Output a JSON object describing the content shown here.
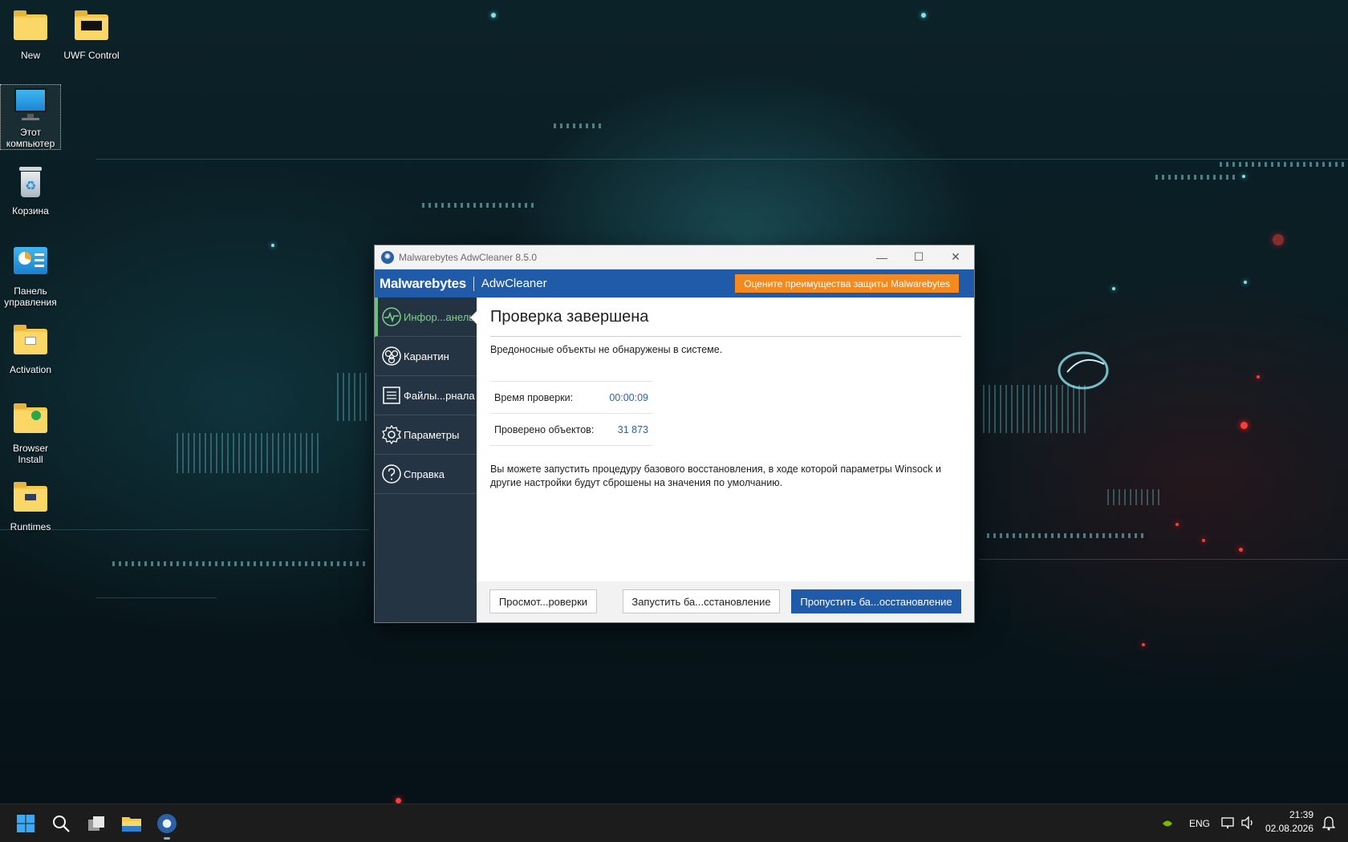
{
  "desktop": {
    "icons": [
      {
        "label": "New"
      },
      {
        "label": "UWF Control"
      },
      {
        "label": "Этот компьютер"
      },
      {
        "label": "Корзина"
      },
      {
        "label": "Панель управления"
      },
      {
        "label": "Activation"
      },
      {
        "label": "Browser Install"
      },
      {
        "label": "Runtimes"
      }
    ]
  },
  "window": {
    "title": "Malwarebytes AdwCleaner 8.5.0",
    "controls": {
      "minimize": "—",
      "maximize": "☐",
      "close": "✕"
    },
    "brand": {
      "logo": "Malwarebytes",
      "product": "AdwCleaner"
    },
    "promo_button": "Оцените преимущества защиты Malwarebytes",
    "sidebar": {
      "items": [
        {
          "label": "Инфор...анель",
          "icon": "pulse-icon",
          "active": true
        },
        {
          "label": "Карантин",
          "icon": "biohazard-icon",
          "active": false
        },
        {
          "label": "Файлы...рнала",
          "icon": "document-icon",
          "active": false
        },
        {
          "label": "Параметры",
          "icon": "gear-icon",
          "active": false
        },
        {
          "label": "Справка",
          "icon": "help-icon",
          "active": false
        }
      ]
    },
    "main": {
      "heading": "Проверка завершена",
      "message": "Вредоносные объекты не обнаружены в системе.",
      "stats": [
        {
          "label": "Время проверки:",
          "value": "00:00:09"
        },
        {
          "label": "Проверено объектов:",
          "value": "31 873"
        }
      ],
      "note": "Вы можете запустить процедуру базового восстановления, в ходе которой параметры Winsock и другие настройки будут сброшены на значения по умолчанию."
    },
    "footer": {
      "view_log": "Просмот...роверки",
      "run_restore": "Запустить ба...сстановление",
      "skip_restore": "Пропустить ба...осстановление"
    }
  },
  "taskbar": {
    "language": "ENG",
    "time": "21:39",
    "date": "02.08.2026"
  },
  "colors": {
    "brand_blue": "#1f5ba8",
    "promo_orange": "#f4891f",
    "sidebar_bg": "#243442",
    "active_green": "#6cc077"
  }
}
